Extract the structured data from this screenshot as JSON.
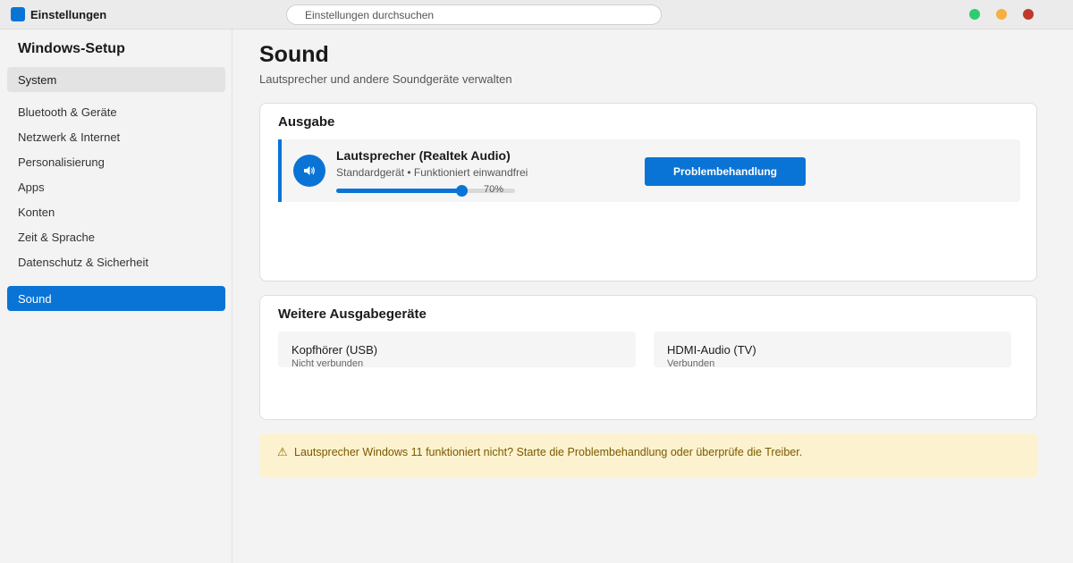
{
  "window": {
    "title": "Einstellungen",
    "search_placeholder": "Einstellungen durchsuchen",
    "controls": [
      "green-dot",
      "yellow-dot",
      "red-dot"
    ]
  },
  "sidebar": {
    "heading": "Windows-Setup",
    "items": [
      {
        "label": "System",
        "state": "selected"
      },
      {
        "label": "Bluetooth & Geräte",
        "state": "normal"
      },
      {
        "label": "Netzwerk & Internet",
        "state": "normal"
      },
      {
        "label": "Personalisierung",
        "state": "normal"
      },
      {
        "label": "Apps",
        "state": "normal"
      },
      {
        "label": "Konten",
        "state": "normal"
      },
      {
        "label": "Zeit & Sprache",
        "state": "normal"
      },
      {
        "label": "Datenschutz & Sicherheit",
        "state": "normal"
      },
      {
        "label": "Sound",
        "state": "active"
      }
    ]
  },
  "main": {
    "title": "Sound",
    "subtitle": "Lautsprecher und andere Soundgeräte verwalten",
    "output": {
      "heading": "Ausgabe",
      "device": {
        "name": "Lautsprecher (Realtek Audio)",
        "status": "Standardgerät • Funktioniert einwandfrei",
        "icon": "speaker-icon",
        "volume_percent": 70,
        "volume_label": "70%"
      },
      "troubleshoot_label": "Problembehandlung"
    },
    "more_devices": {
      "heading": "Weitere Ausgabegeräte",
      "devices": [
        {
          "name": "Kopfhörer (USB)",
          "status": "Nicht verbunden"
        },
        {
          "name": "HDMI-Audio (TV)",
          "status": "Verbunden"
        }
      ]
    },
    "warning": {
      "icon": "warning-icon",
      "glyph": "⚠",
      "text": "Lautsprecher Windows 11 funktioniert nicht? Starte die Problembehandlung oder überprüfe die Treiber."
    }
  },
  "colors": {
    "accent": "#0a74d6",
    "warning_bg": "#fdf2cf",
    "warning_text": "#7a5a00"
  }
}
